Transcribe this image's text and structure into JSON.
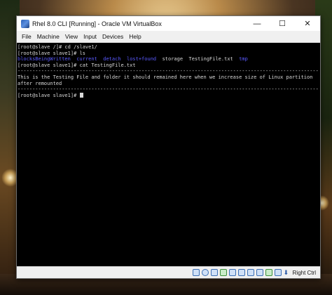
{
  "window": {
    "title": "Rhel 8.0 CLI [Running] - Oracle VM VirtualBox",
    "controls": {
      "minimize": "—",
      "maximize": "☐",
      "close": "✕"
    }
  },
  "menu": [
    "File",
    "Machine",
    "View",
    "Input",
    "Devices",
    "Help"
  ],
  "terminal": {
    "lines": [
      "[root@slave /]# cd /slave1/",
      "[root@slave slave1]# ls",
      "",
      "[root@slave slave1]# cat TestingFile.txt",
      "------------------------------------------------------------------------------------------------------",
      "This is the Testing File and folder it should remained here when we increase size of Linux partition",
      "after remounted",
      "------------------------------------------------------------------------------------------------------",
      "[root@slave slave1]# "
    ],
    "ls_output": [
      {
        "name": "blocksBeingWritten",
        "dir": true
      },
      {
        "name": "current",
        "dir": true
      },
      {
        "name": "detach",
        "dir": true
      },
      {
        "name": "lost+found",
        "dir": true
      },
      {
        "name": "storage",
        "dir": false
      },
      {
        "name": "TestingFile.txt",
        "dir": false
      },
      {
        "name": "tmp",
        "dir": true
      }
    ],
    "dir_color": "#5a5aff",
    "text_color": "#d8d8d8"
  },
  "statusbar": {
    "host_key": "Right Ctrl",
    "icons": [
      "hard-disk-icon",
      "optical-drive-icon",
      "audio-icon",
      "network-icon",
      "usb-icon",
      "shared-folder-icon",
      "display-icon",
      "video-capture-icon",
      "cpu-icon",
      "mouse-integration-icon",
      "keyboard-icon"
    ]
  }
}
